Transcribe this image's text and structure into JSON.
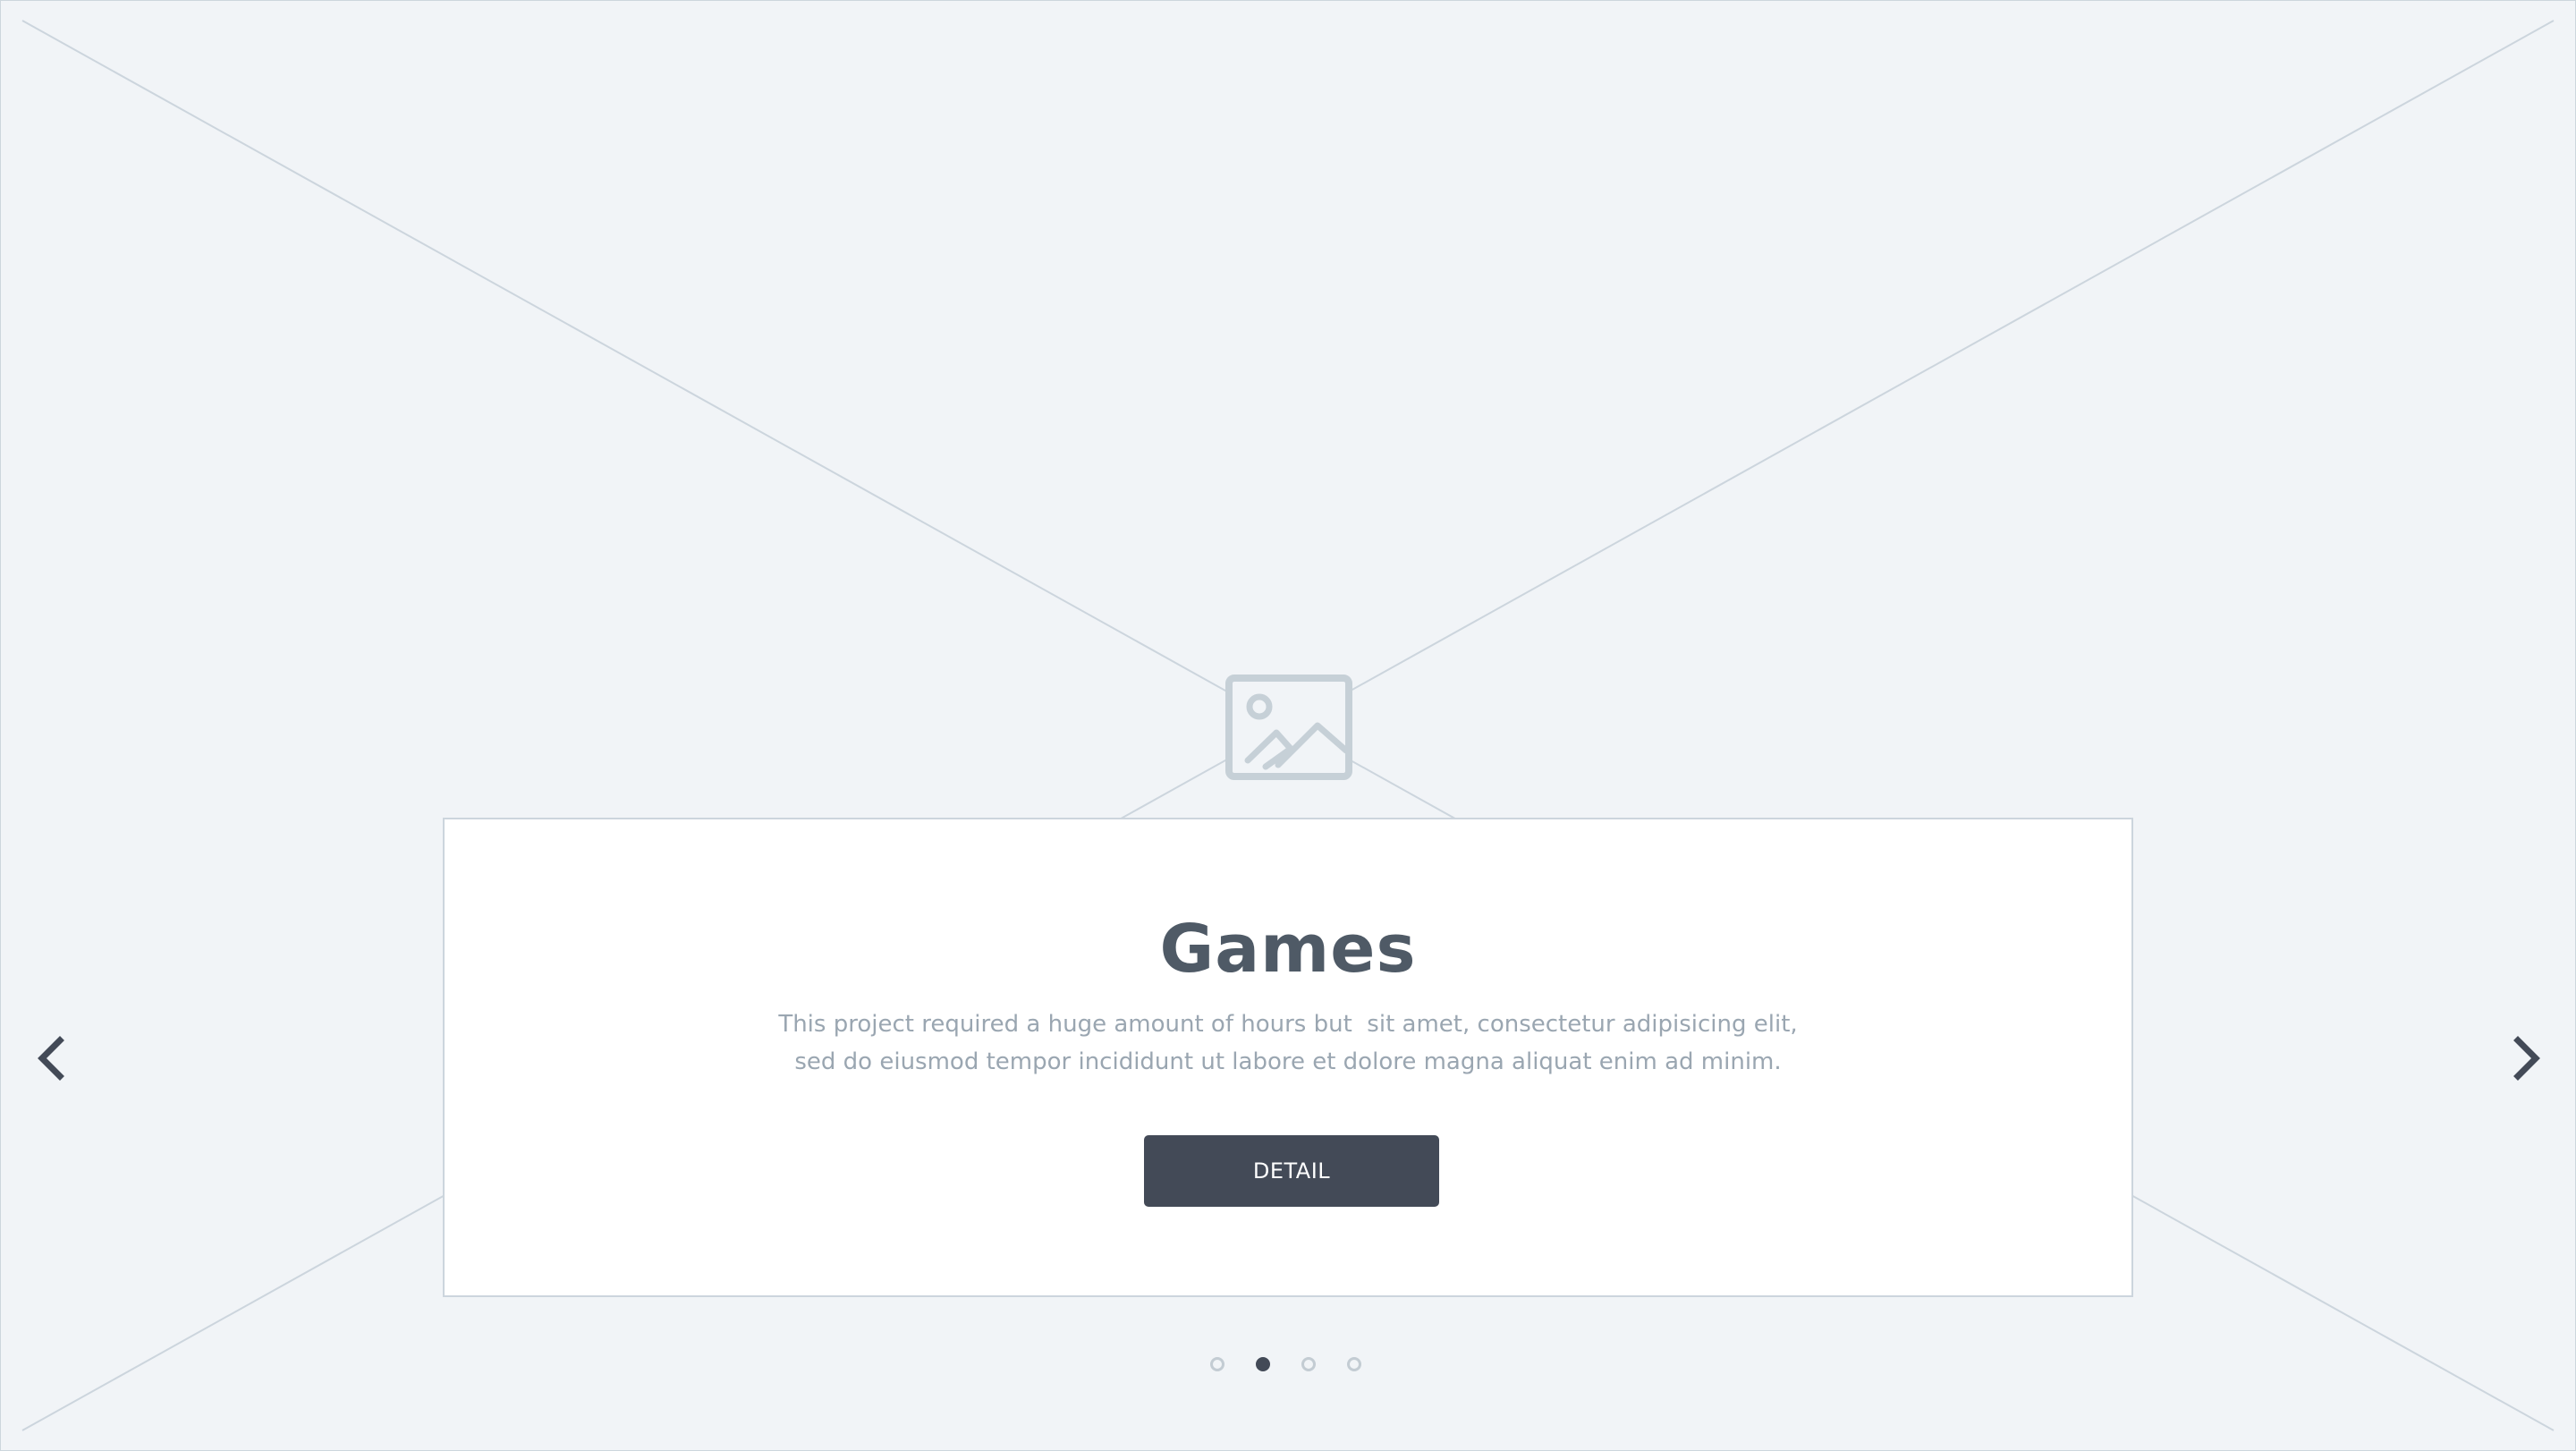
{
  "slider": {
    "title": "Games",
    "description_lines": [
      "This project required a huge amount of hours but  sit amet, consectetur adipisicing elit,",
      "sed do eiusmod tempor incididunt ut labore et dolore magna aliquat enim ad minim."
    ],
    "button_label": "DETAIL",
    "slide_count": 4,
    "active_slide": 2,
    "icons": {
      "placeholder": "image-placeholder-icon",
      "prev": "chevron-left-icon",
      "next": "chevron-right-icon"
    }
  },
  "colors": {
    "background": "#f1f4f7",
    "lines": "#ccd5dd",
    "title": "#4f5a66",
    "text": "#9aa6b1",
    "button": "#434a57",
    "icon": "#c6d0d7"
  }
}
